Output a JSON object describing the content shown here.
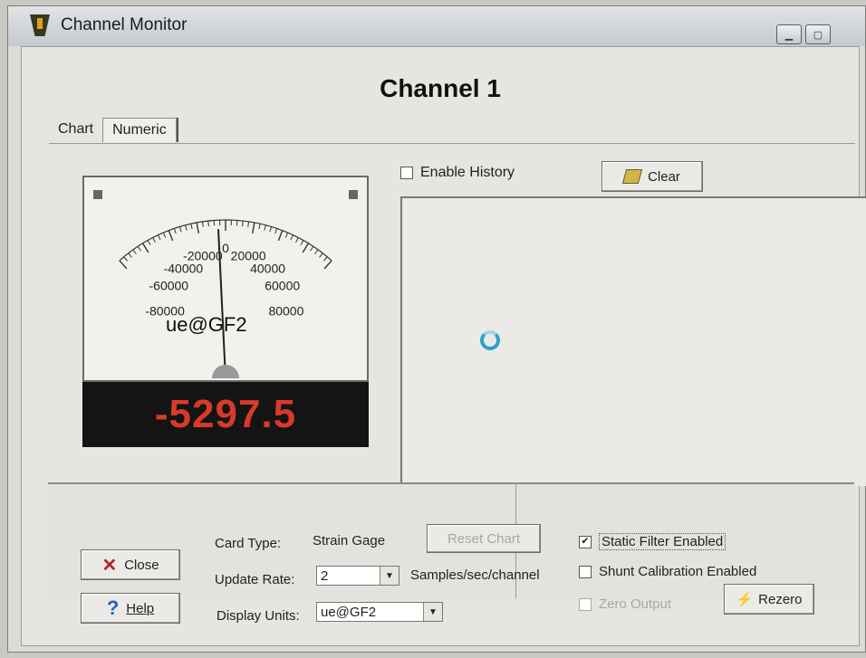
{
  "window": {
    "title": "Channel Monitor",
    "minimize_icon": "minimize-icon",
    "maximize_icon": "maximize-icon"
  },
  "header": {
    "channel_title": "Channel 1"
  },
  "tabs": [
    {
      "label": "Chart",
      "active": false
    },
    {
      "label": "Numeric",
      "active": true
    }
  ],
  "meter": {
    "scale_labels": [
      "-80000",
      "-60000",
      "-40000",
      "-20000",
      "0",
      "20000",
      "40000",
      "60000",
      "80000"
    ],
    "unit_label": "ue@GF2",
    "readout": "-5297.5",
    "readout_color": "#d83a2a",
    "needle_value": -5297.5
  },
  "history": {
    "enable_label": "Enable History",
    "enabled": false,
    "clear_label": "Clear",
    "clear_icon": "eraser-icon"
  },
  "spinner_icon": "loading-spinner-icon",
  "bottom": {
    "close_label": "Close",
    "help_label": "Help",
    "card_type_label": "Card Type:",
    "card_type_value": "Strain Gage",
    "reset_chart_label": "Reset Chart",
    "update_rate_label": "Update Rate:",
    "update_rate_value": "2",
    "update_rate_units": "Samples/sec/channel",
    "display_units_label": "Display Units:",
    "display_units_value": "ue@GF2",
    "static_filter_label": "Static Filter Enabled",
    "static_filter_checked": true,
    "shunt_label": "Shunt Calibration Enabled",
    "shunt_checked": false,
    "zero_output_label": "Zero Output",
    "rezero_label": "Rezero"
  }
}
